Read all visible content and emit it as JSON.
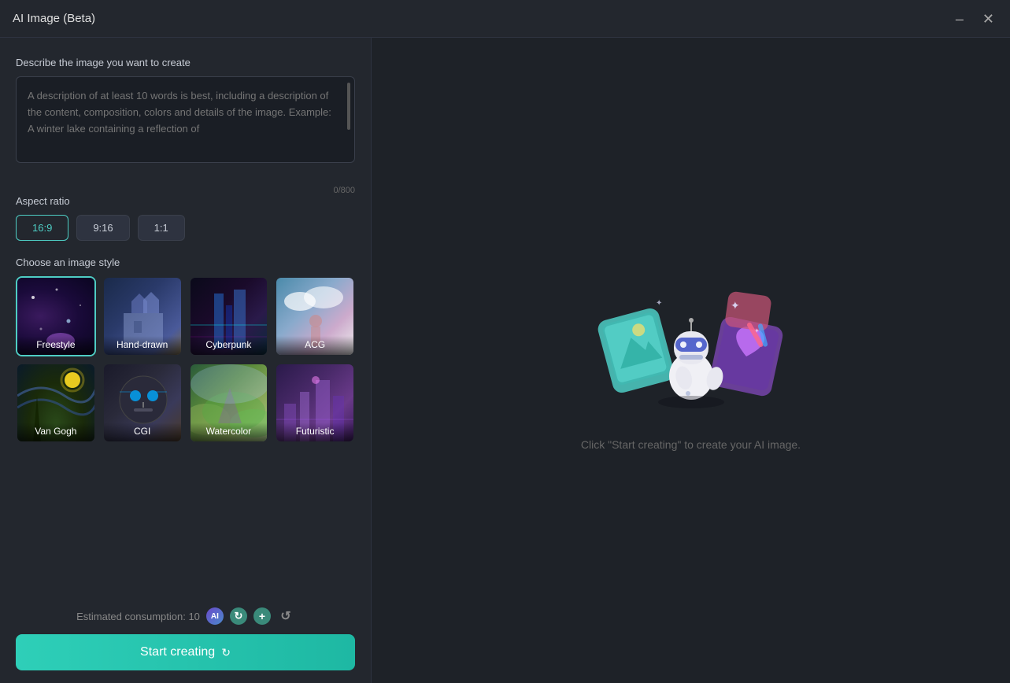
{
  "window": {
    "title": "AI Image (Beta)"
  },
  "controls": {
    "minimize": "–",
    "close": "✕"
  },
  "left": {
    "describe_label": "Describe the image you want to create",
    "textarea_placeholder": "A description of at least 10 words is best, including a description of the content, composition, colors and details of the image. Example: A winter lake containing a reflection of",
    "char_count": "0/800",
    "aspect_label": "Aspect ratio",
    "aspects": [
      "16:9",
      "9:16",
      "1:1"
    ],
    "active_aspect": "16:9",
    "style_label": "Choose an image style",
    "styles": [
      {
        "id": "freestyle",
        "label": "Freestyle",
        "selected": true
      },
      {
        "id": "hand-drawn",
        "label": "Hand-drawn",
        "selected": false
      },
      {
        "id": "cyberpunk",
        "label": "Cyberpunk",
        "selected": false
      },
      {
        "id": "acg",
        "label": "ACG",
        "selected": false
      },
      {
        "id": "vangogh",
        "label": "Van Gogh",
        "selected": false
      },
      {
        "id": "cgi",
        "label": "CGI",
        "selected": false
      },
      {
        "id": "watercolor",
        "label": "Watercolor",
        "selected": false
      },
      {
        "id": "futuristic",
        "label": "Futuristic",
        "selected": false
      }
    ],
    "consumption_label": "Estimated consumption: 10",
    "start_btn_label": "Start creating"
  },
  "right": {
    "hint": "Click \"Start creating\" to create your AI image."
  }
}
